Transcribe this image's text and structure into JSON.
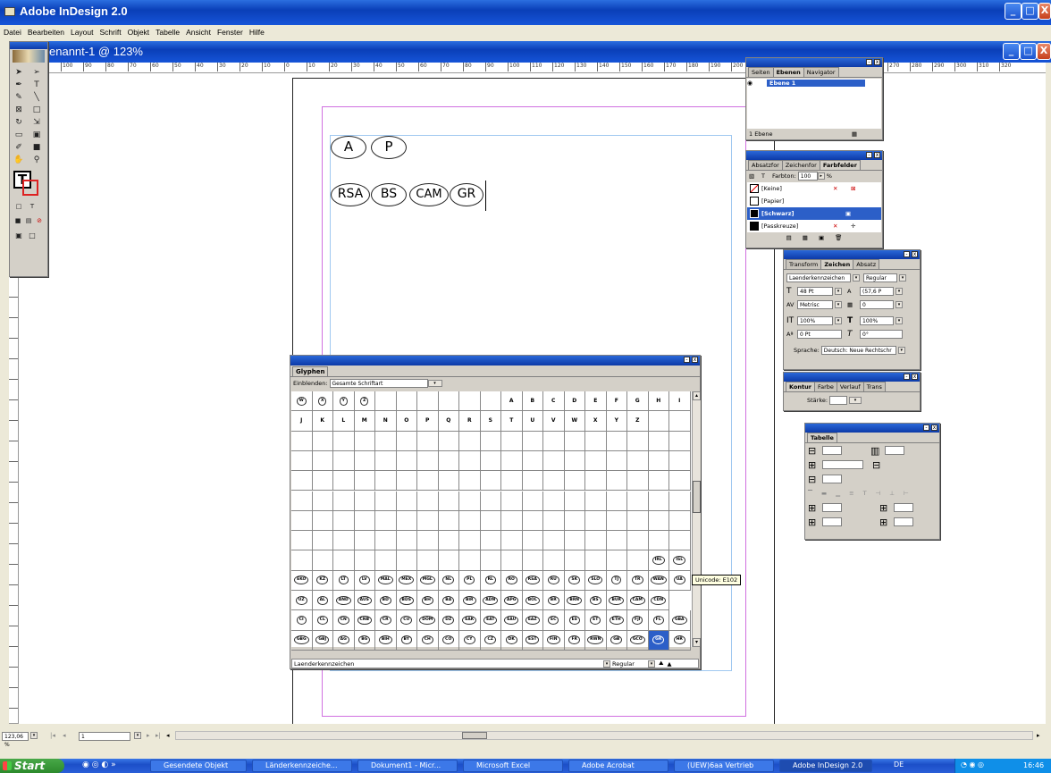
{
  "app": {
    "title": "Adobe InDesign 2.0"
  },
  "menu": [
    "Datei",
    "Bearbeiten",
    "Layout",
    "Schrift",
    "Objekt",
    "Tabelle",
    "Ansicht",
    "Fenster",
    "Hilfe"
  ],
  "document": {
    "title": "enannt-1 @ 123%"
  },
  "ruler": {
    "labels": [
      "100",
      "90",
      "80",
      "70",
      "60",
      "50",
      "40",
      "30",
      "20",
      "10",
      "0",
      "10",
      "20",
      "30",
      "40",
      "50",
      "60",
      "70",
      "80",
      "90",
      "100",
      "110",
      "120",
      "130",
      "140",
      "150",
      "160",
      "170",
      "180",
      "190",
      "200",
      "210",
      "220",
      "230",
      "240",
      "250",
      "260",
      "270",
      "280",
      "290",
      "300",
      "310",
      "320"
    ]
  },
  "page": {
    "row1": [
      "A",
      "P"
    ],
    "row2": [
      "RSA",
      "BS",
      "CAM",
      "GR"
    ]
  },
  "layers_panel": {
    "tabs": [
      "Seiten",
      "Ebenen",
      "Navigator"
    ],
    "layer": "Ebene 1",
    "footer": "1 Ebene"
  },
  "swatches_panel": {
    "tabs": [
      "Absatzfor",
      "Zeichenfor",
      "Farbfelder"
    ],
    "tint_label": "Farbton:",
    "tint_value": "100",
    "tint_unit": "%",
    "swatches": [
      "[Keine]",
      "[Papier]",
      "[Schwarz]",
      "[Passkreuze]"
    ]
  },
  "character_panel": {
    "tabs": [
      "Transform",
      "Zeichen",
      "Absatz"
    ],
    "font": "Laenderkennzeichen",
    "style": "Regular",
    "size": "48 Pt",
    "leading": "(57,6 P",
    "kerning": "Metrisc",
    "tracking": "0",
    "vscale": "100%",
    "hscale": "100%",
    "baseline": "0 Pt",
    "skew": "0°",
    "lang_label": "Sprache:",
    "lang_value": "Deutsch: Neue Rechtschr"
  },
  "stroke_panel": {
    "tabs": [
      "Kontur",
      "Farbe",
      "Verlauf",
      "Trans"
    ],
    "weight_label": "Stärke:"
  },
  "table_panel": {
    "tab": "Tabelle"
  },
  "glyphs_panel": {
    "tab": "Glyphen",
    "show_label": "Einblenden:",
    "show_value": "Gesamte Schriftart",
    "font": "Laenderkennzeichen",
    "style": "Regular",
    "tooltip": "Unicode: E102",
    "row1": [
      "W",
      "X",
      "Y",
      "Z",
      "",
      "",
      "",
      "",
      "",
      "",
      "A",
      "B",
      "C",
      "D",
      "E",
      "F",
      "G",
      "H",
      "I"
    ],
    "row2": [
      "J",
      "K",
      "L",
      "M",
      "N",
      "O",
      "P",
      "Q",
      "R",
      "S",
      "T",
      "U",
      "V",
      "W",
      "X",
      "Y",
      "Z",
      "",
      ""
    ],
    "row_irl": [
      "",
      "",
      "",
      "",
      "",
      "",
      "",
      "",
      "",
      "",
      "",
      "",
      "",
      "",
      "",
      "",
      "",
      "IRL",
      "ISL"
    ],
    "row_a": [
      "EKO",
      "KZ",
      "LT",
      "LV",
      "MAL",
      "MEX",
      "MGL",
      "NL",
      "PL",
      "RL",
      "RO",
      "RSA",
      "RU",
      "SK",
      "SLO",
      "TJ",
      "TR",
      "WAN",
      "UA"
    ],
    "row_b": [
      "UZ",
      "AL",
      "AND",
      "AUS",
      "BD",
      "BDS",
      "BH",
      "BA",
      "BIR",
      "ADN",
      "APG",
      "BOL",
      "BR",
      "BRN",
      "BS",
      "BUR",
      "CAM",
      "CDN"
    ],
    "row_c": [
      "CI",
      "CL",
      "CN",
      "CNB",
      "CR",
      "CU",
      "DOM",
      "DZ",
      "EAK",
      "EAT",
      "EAU",
      "EAZ",
      "EC",
      "ES",
      "ET",
      "ETH",
      "FJI",
      "FL",
      "GBA"
    ],
    "row_d": [
      "GBG",
      "GBJ",
      "AG",
      "BG",
      "BIH",
      "BY",
      "CH",
      "CO",
      "CY",
      "CZ",
      "DK",
      "EST",
      "FIN",
      "FR",
      "RWN",
      "GB",
      "GCO",
      "GR",
      "HR"
    ]
  },
  "status": {
    "zoom": "123,06 %",
    "page": "1"
  },
  "taskbar": {
    "start": "Start",
    "items": [
      "Gesendete Objekt",
      "Länderkennzeiche...",
      "Dokument1 - Micr...",
      "Microsoft Excel",
      "Adobe Acrobat",
      "(UEW)6aa Vertrieb",
      "Adobe InDesign 2.0"
    ],
    "lang": "DE",
    "time": "16:46"
  }
}
